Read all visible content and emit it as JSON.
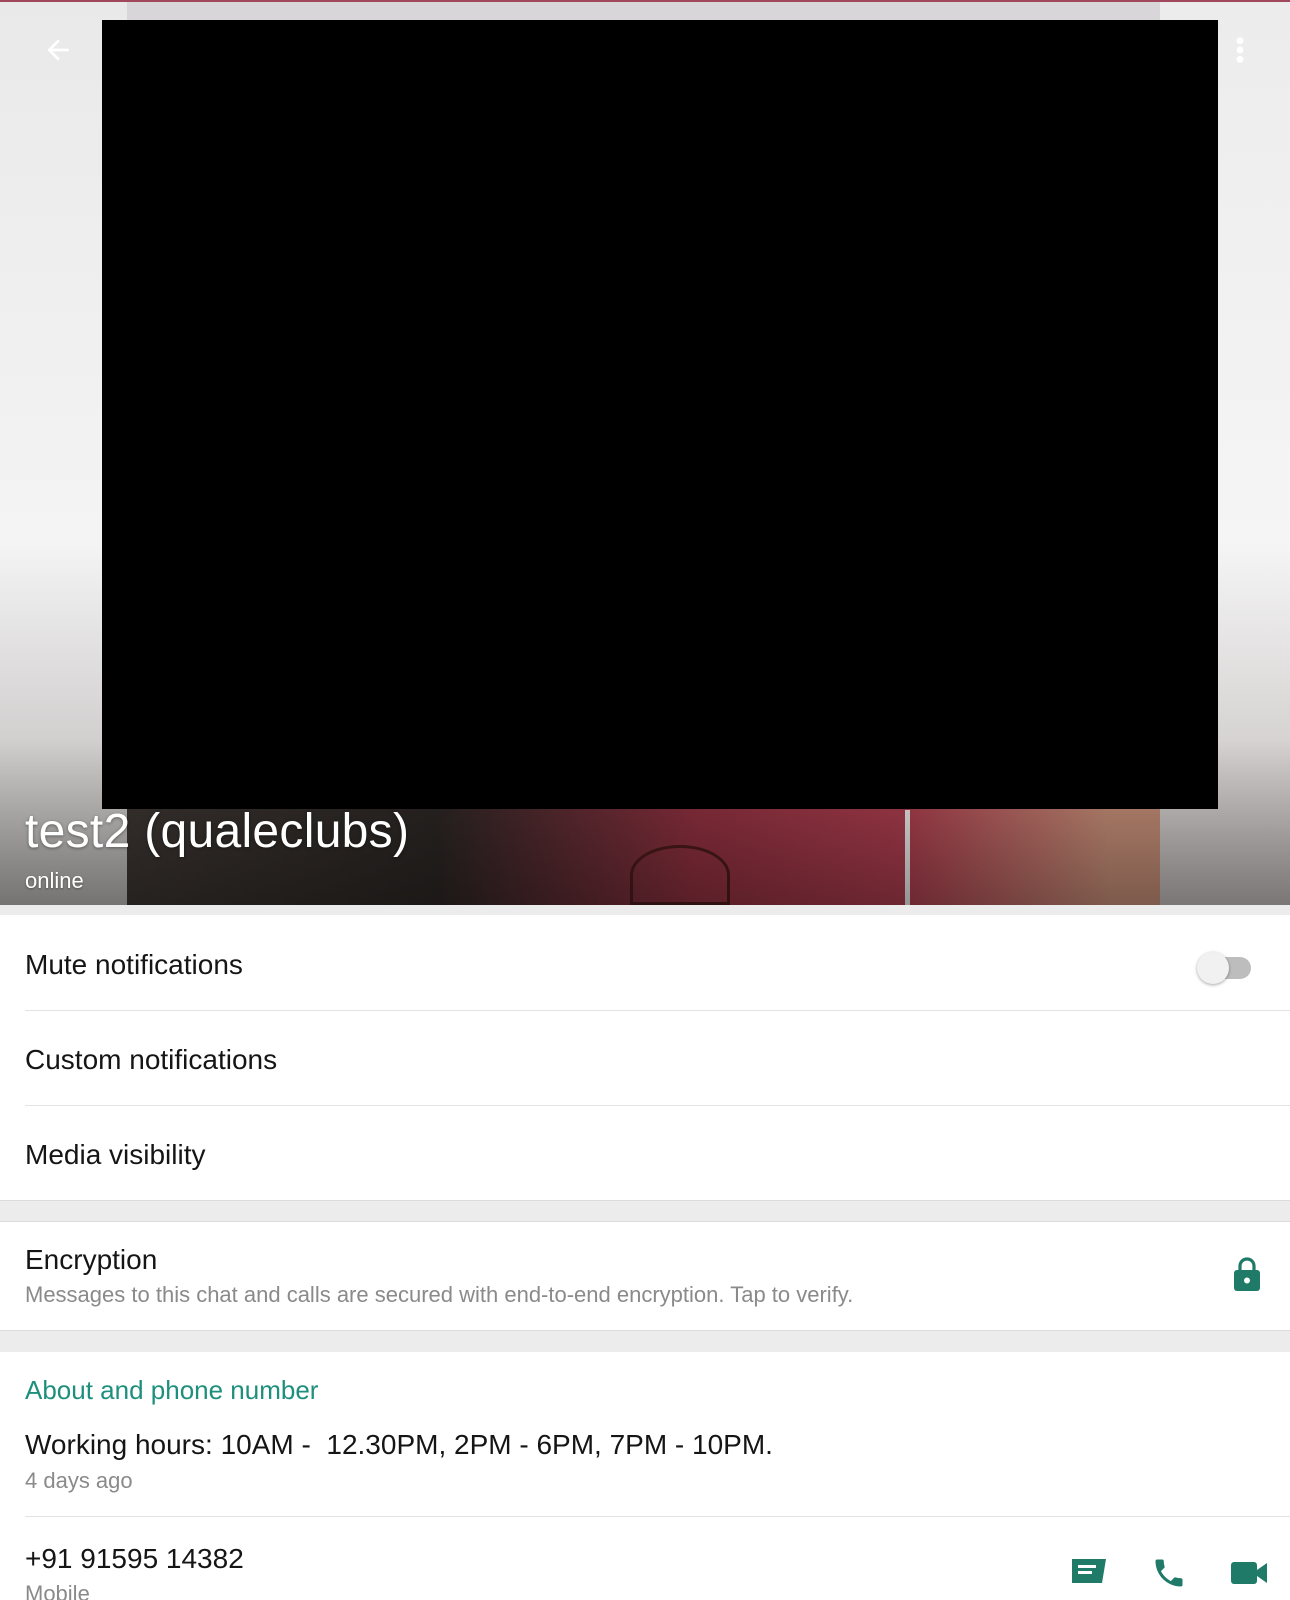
{
  "header": {
    "contact_name": "test2 (qualeclubs)",
    "status": "online",
    "back_icon": "arrow-left-icon",
    "menu_icon": "more-vert-icon"
  },
  "settings": {
    "mute_label": "Mute notifications",
    "mute_enabled": false,
    "custom_label": "Custom notifications",
    "media_label": "Media visibility"
  },
  "encryption": {
    "title": "Encryption",
    "subtitle": "Messages to this chat and calls are secured with end-to-end encryption. Tap to verify.",
    "icon": "lock-icon"
  },
  "about": {
    "heading": "About and phone number",
    "text": "Working hours: 10AM -  12.30PM, 2PM - 6PM, 7PM - 10PM.",
    "time": "4 days ago",
    "phone": "+91 91595 14382",
    "phone_type": "Mobile",
    "action_icons": [
      "message-icon",
      "phone-call-icon",
      "video-call-icon"
    ]
  },
  "colors": {
    "accent": "#1e8f7c",
    "icon_green": "#1f7a67"
  }
}
